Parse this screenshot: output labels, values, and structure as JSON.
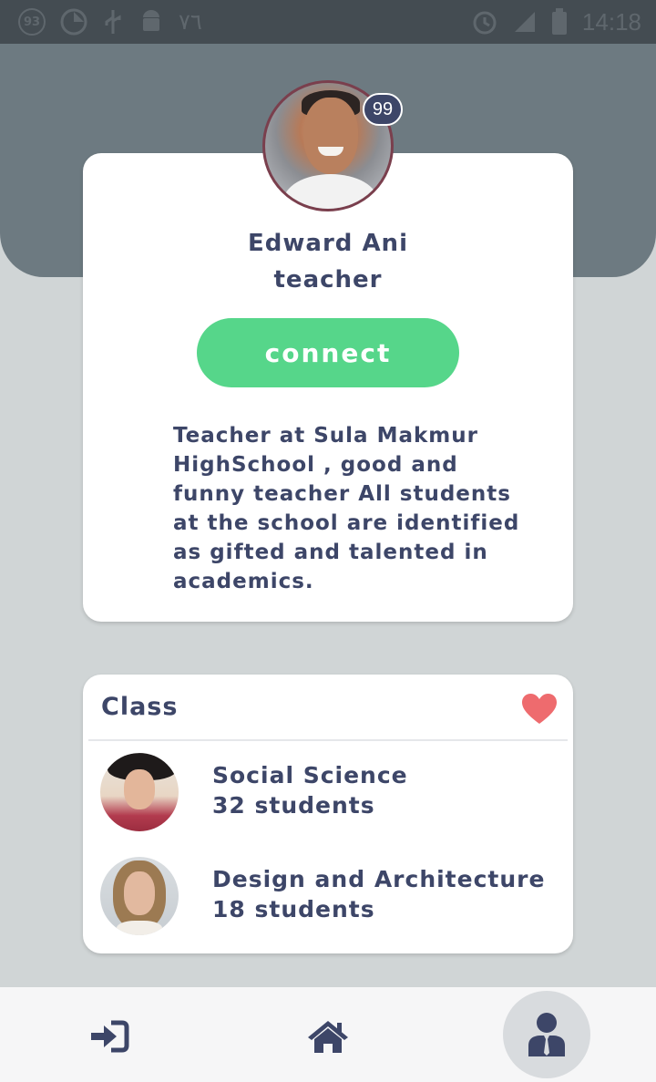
{
  "status_bar": {
    "left_icons": [
      "notification-count-icon",
      "pinwheel-icon",
      "usb-icon",
      "android-icon",
      "arabic-app-icon"
    ],
    "notification_count": "93",
    "arabic_glyph": "٧٦",
    "right_icons": [
      "alarm-icon",
      "signal-icon",
      "battery-icon"
    ],
    "time": "14:18"
  },
  "profile": {
    "badge_count": "99",
    "name": "Edward Ani",
    "role": "teacher",
    "connect_label": "connect",
    "bio": "Teacher at Sula Makmur HighSchool , good and funny teacher All students at the school are identified as gifted and talented in academics."
  },
  "classes": {
    "title": "Class",
    "items": [
      {
        "name": "Social Science",
        "count": "32 students"
      },
      {
        "name": "Design and Architecture",
        "count": "18 students"
      }
    ]
  },
  "nav": {
    "items": [
      "login-icon",
      "home-icon",
      "profile-icon"
    ],
    "active": "profile-icon"
  },
  "colors": {
    "header": "#6d7a81",
    "background": "#d0d5d6",
    "accent_green": "#56d68a",
    "text": "#3d4668",
    "heart": "#ee6b6e"
  }
}
